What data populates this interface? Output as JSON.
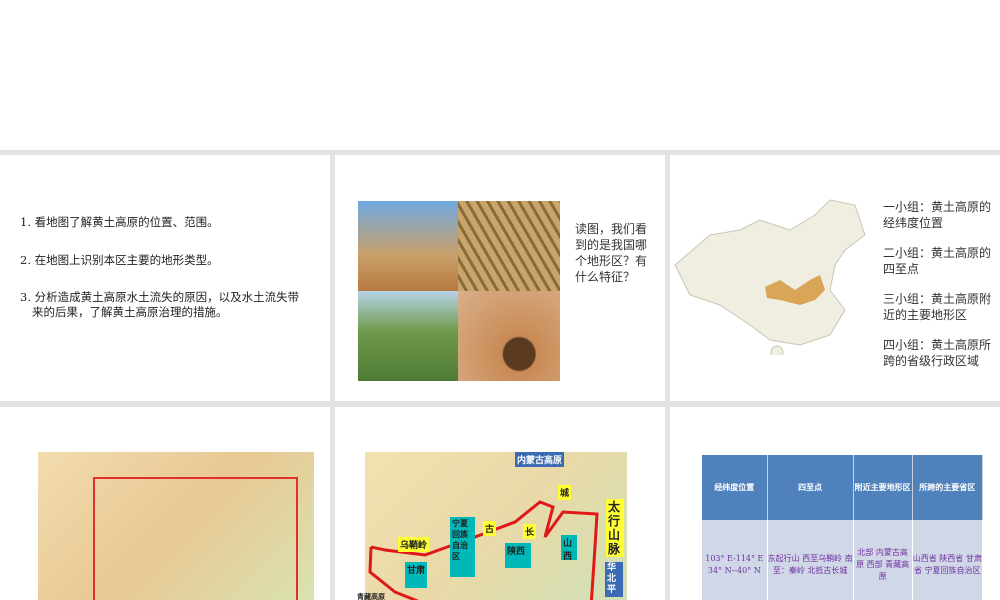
{
  "slide1": {
    "items": [
      "1. 看地图了解黄土高原的位置、范围。",
      "2. 在地图上识别本区主要的地形类型。",
      "3. 分析造成黄土高原水土流失的原因，以及水土流失带来的后果，了解黄土高原治理的措施。"
    ]
  },
  "slide2": {
    "question": "读图，我们看到的是我国哪个地形区？有什么特征？"
  },
  "slide3": {
    "groups": [
      "一小组：黄土高原的经纬度位置",
      "二小组：黄土高原的四至点",
      "三小组：黄土高原附近的主要地形区",
      "四小组：黄土高原所跨的省级行政区域"
    ]
  },
  "slide5": {
    "labels": {
      "inner_mongolia": "内蒙古高原",
      "taihang": "太行山脉",
      "north_china": "华北平",
      "ningxia": "宁夏回族自治区",
      "wushaoling": "乌鞘岭",
      "gansu": "甘肃",
      "shaanxi": "陕西",
      "shanxi": "山西",
      "chang": "长",
      "cheng": "城",
      "gu": "古",
      "qinghai": "青藏高原"
    }
  },
  "slide6": {
    "headers": [
      "经纬度位置",
      "四至点",
      "附近主要地形区",
      "所跨的主要省区"
    ],
    "row": [
      "103° E-114° E 34° N--40° N",
      "东起行山 西至乌鞘岭 南至：秦岭 北抵古长城",
      "北部 内蒙古高原 西部 青藏高原",
      "山西省 陕西省 甘肃省 宁夏回族自治区"
    ]
  }
}
